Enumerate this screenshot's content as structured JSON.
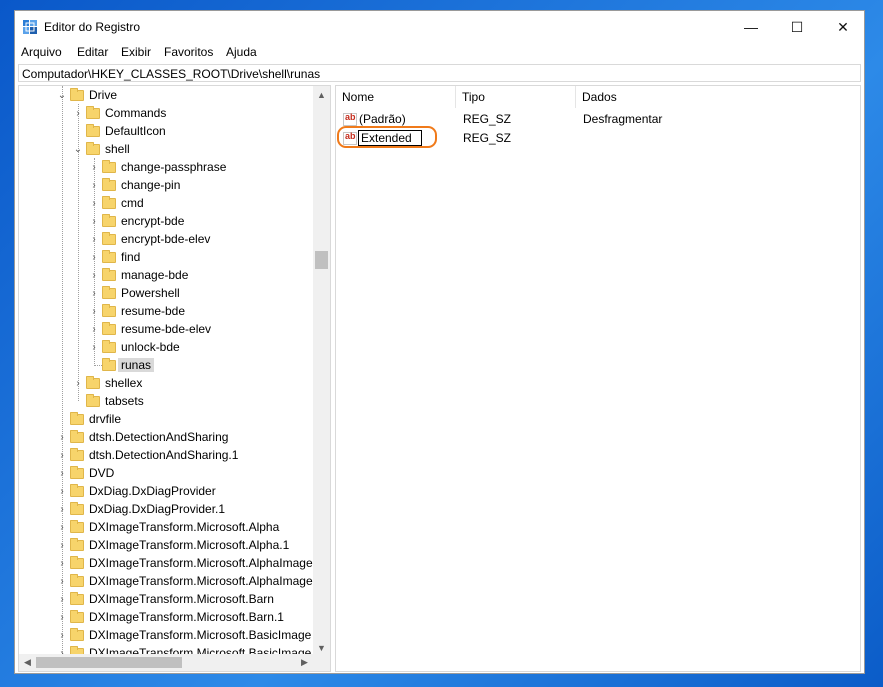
{
  "window": {
    "title": "Editor do Registro",
    "controls": {
      "minimize": "—",
      "maximize": "☐",
      "close": "✕"
    }
  },
  "menu": [
    "Arquivo",
    "Editar",
    "Exibir",
    "Favoritos",
    "Ajuda"
  ],
  "address": "Computador\\HKEY_CLASSES_ROOT\\Drive\\shell\\runas",
  "tree": {
    "drive": "Drive",
    "drive_children": [
      "Commands",
      "DefaultIcon",
      "shell"
    ],
    "shell_children": [
      "change-passphrase",
      "change-pin",
      "cmd",
      "encrypt-bde",
      "encrypt-bde-elev",
      "find",
      "manage-bde",
      "Powershell",
      "resume-bde",
      "resume-bde-elev",
      "unlock-bde",
      "runas"
    ],
    "selected": "runas",
    "drive_children_after": [
      "shellex",
      "tabsets"
    ],
    "root_items": [
      "drvfile",
      "dtsh.DetectionAndSharing",
      "dtsh.DetectionAndSharing.1",
      "DVD",
      "DxDiag.DxDiagProvider",
      "DxDiag.DxDiagProvider.1",
      "DXImageTransform.Microsoft.Alpha",
      "DXImageTransform.Microsoft.Alpha.1",
      "DXImageTransform.Microsoft.AlphaImage",
      "DXImageTransform.Microsoft.AlphaImage",
      "DXImageTransform.Microsoft.Barn",
      "DXImageTransform.Microsoft.Barn.1",
      "DXImageTransform.Microsoft.BasicImage",
      "DXImageTransform.Microsoft.BasicImage"
    ]
  },
  "list": {
    "columns": [
      "Nome",
      "Tipo",
      "Dados"
    ],
    "rows": [
      {
        "name": "(Padrão)",
        "type": "REG_SZ",
        "data": "Desfragmentar"
      },
      {
        "name": "Extended",
        "type": "REG_SZ",
        "data": ""
      }
    ]
  },
  "accent": {
    "highlight": "#f07a1a",
    "selection": "#d9d9d9",
    "folder": "#f7d46b"
  }
}
